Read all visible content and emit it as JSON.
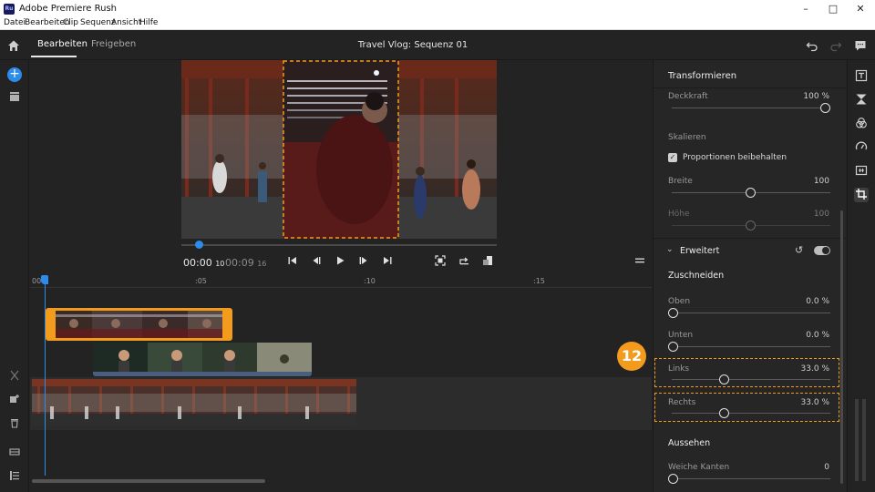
{
  "window": {
    "title": "Adobe Premiere Rush",
    "app_icon_text": "Ru"
  },
  "menu": [
    "Datei",
    "Bearbeiten",
    "Clip",
    "Sequenz",
    "Ansicht",
    "Hilfe"
  ],
  "header": {
    "tabs": [
      "Bearbeiten",
      "Freigeben"
    ],
    "active_tab": "Bearbeiten",
    "project_title": "Travel Vlog: Sequenz 01"
  },
  "preview": {
    "current_time": "00:00",
    "current_frames": "10",
    "duration_time": "00:09",
    "duration_frames": "16"
  },
  "timeline": {
    "ruler_labels": [
      "00",
      ":05",
      ":10",
      ":15"
    ]
  },
  "panel": {
    "title": "Transformieren",
    "deckkraft_label": "Deckkraft",
    "deckkraft_value": "100",
    "deckkraft_unit": "%",
    "skalieren_label": "Skalieren",
    "proportionen_label": "Proportionen beibehalten",
    "breite_label": "Breite",
    "breite_value": "100",
    "hoehe_label": "Höhe",
    "hoehe_value": "100",
    "erweitert_label": "Erweitert",
    "zuschneiden_label": "Zuschneiden",
    "oben_label": "Oben",
    "oben_value": "0.0",
    "unten_label": "Unten",
    "unten_value": "0.0",
    "links_label": "Links",
    "links_value": "33.0",
    "rechts_label": "Rechts",
    "rechts_value": "33.0",
    "percent": "%",
    "aussehen_label": "Aussehen",
    "weiche_kanten_label": "Weiche Kanten",
    "weiche_kanten_value": "0",
    "slider_levels": {
      "deckkraft": 1.0,
      "breite": 0.5,
      "hoehe": 0.5,
      "oben": 0.0,
      "unten": 0.0,
      "links": 0.33,
      "rechts": 0.33,
      "weiche_kanten": 0.0
    }
  },
  "callout": {
    "number": "12",
    "color": "#f29b1c"
  },
  "colors": {
    "accent": "#2d8ceb",
    "selection": "#f29b1c"
  },
  "icons": [
    "home-icon",
    "plus-icon",
    "media-icon",
    "scissors-icon",
    "duplicate-icon",
    "trash-icon",
    "track-icon",
    "list-icon",
    "undo-icon",
    "redo-icon",
    "chat-icon",
    "titles-icon",
    "transitions-icon",
    "color-icon",
    "speed-icon",
    "audio-icon",
    "crop-icon"
  ]
}
